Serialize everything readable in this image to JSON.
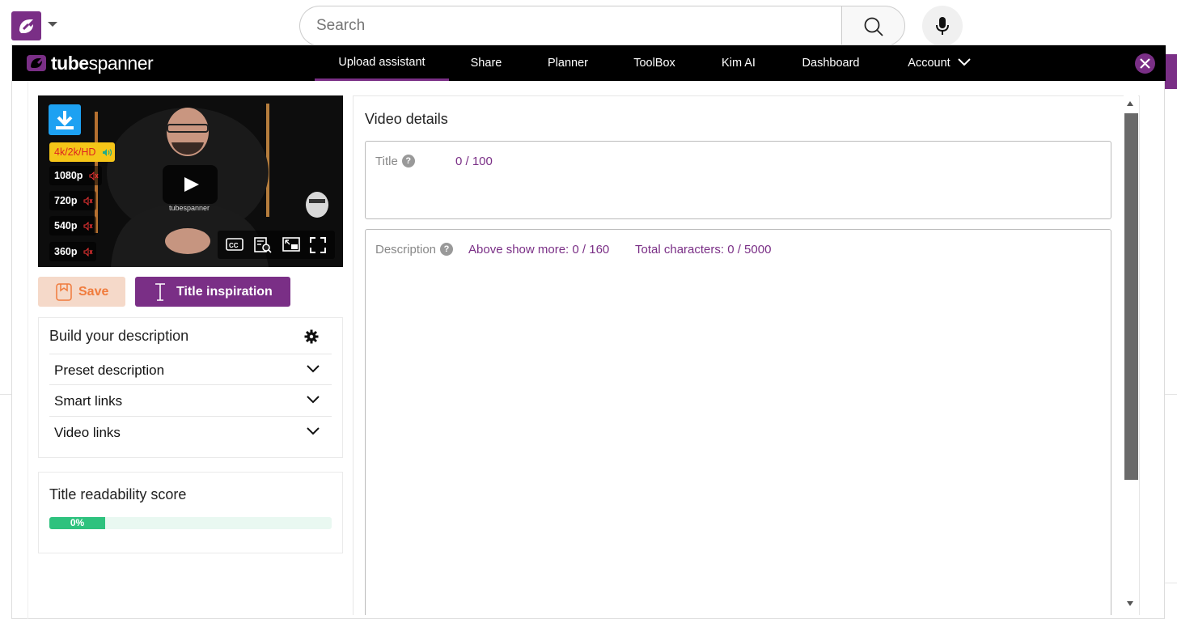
{
  "youtube": {
    "search_placeholder": "Search"
  },
  "tubespanner": {
    "logo_bold": "tube",
    "logo_light": "spanner",
    "nav": [
      {
        "label": "Upload assistant",
        "active": true
      },
      {
        "label": "Share"
      },
      {
        "label": "Planner"
      },
      {
        "label": "ToolBox"
      },
      {
        "label": "Kim AI"
      },
      {
        "label": "Dashboard"
      },
      {
        "label": "Account"
      }
    ]
  },
  "video": {
    "resolutions": [
      {
        "label": "4k/2k/HD",
        "sound": true
      },
      {
        "label": "1080p",
        "sound": false
      },
      {
        "label": "720p",
        "sound": false
      },
      {
        "label": "540p",
        "sound": false
      },
      {
        "label": "360p",
        "sound": false
      }
    ],
    "shirt_text": "tubespanner"
  },
  "buttons": {
    "save": "Save",
    "title_inspiration": "Title inspiration"
  },
  "build": {
    "title": "Build your description",
    "items": [
      "Preset description",
      "Smart links",
      "Video links"
    ]
  },
  "readability": {
    "title": "Title readability score",
    "value_label": "0%",
    "percent": 0
  },
  "details": {
    "title": "Video details",
    "title_field": {
      "label": "Title",
      "count": "0 / 100"
    },
    "desc_field": {
      "label": "Description",
      "above_more": "Above show more: 0 / 160",
      "total": "Total characters: 0 / 5000"
    }
  },
  "colors": {
    "brand_purple": "#7a2f86",
    "save_orange": "#f07b3c",
    "progress_green": "#2ec27e",
    "download_blue": "#1da1f2"
  }
}
